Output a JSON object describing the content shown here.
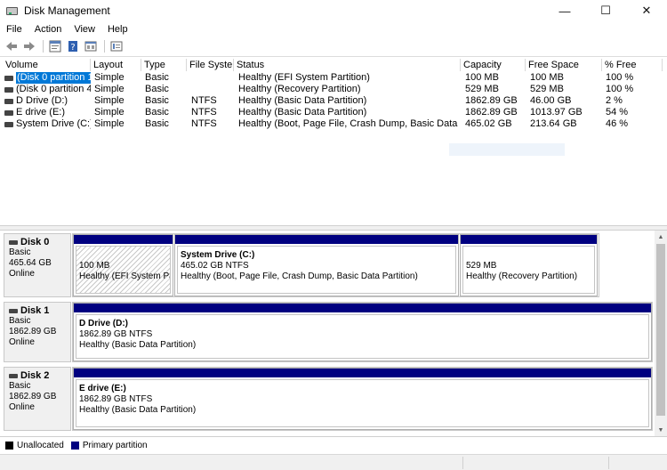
{
  "window": {
    "title": "Disk Management",
    "minimize_glyph": "—",
    "maximize_glyph": "☐",
    "close_glyph": "✕"
  },
  "menu": [
    "File",
    "Action",
    "View",
    "Help"
  ],
  "toolbar": {
    "icons": [
      "back-arrow-icon",
      "forward-arrow-icon",
      "properties-icon",
      "help-icon",
      "show-hide-pane-icon",
      "console-tree-icon"
    ]
  },
  "volume_list": {
    "columns": [
      "Volume",
      "Layout",
      "Type",
      "File Syste...",
      "Status",
      "Capacity",
      "Free Space",
      "% Free"
    ],
    "rows": [
      {
        "volume": "(Disk 0 partition 1)",
        "layout": "Simple",
        "type": "Basic",
        "fs": "",
        "status": "Healthy (EFI System Partition)",
        "capacity": "100 MB",
        "free": "100 MB",
        "pct": "100 %",
        "selected": true
      },
      {
        "volume": "(Disk 0 partition 4)",
        "layout": "Simple",
        "type": "Basic",
        "fs": "",
        "status": "Healthy (Recovery Partition)",
        "capacity": "529 MB",
        "free": "529 MB",
        "pct": "100 %",
        "selected": false
      },
      {
        "volume": "D Drive (D:)",
        "layout": "Simple",
        "type": "Basic",
        "fs": "NTFS",
        "status": "Healthy (Basic Data Partition)",
        "capacity": "1862.89 GB",
        "free": "46.00 GB",
        "pct": "2 %",
        "selected": false
      },
      {
        "volume": "E drive (E:)",
        "layout": "Simple",
        "type": "Basic",
        "fs": "NTFS",
        "status": "Healthy (Basic Data Partition)",
        "capacity": "1862.89 GB",
        "free": "1013.97 GB",
        "pct": "54 %",
        "selected": false
      },
      {
        "volume": "System Drive (C:)",
        "layout": "Simple",
        "type": "Basic",
        "fs": "NTFS",
        "status": "Healthy (Boot, Page File, Crash Dump, Basic Data Partition)",
        "capacity": "465.02 GB",
        "free": "213.64 GB",
        "pct": "46 %",
        "selected": false
      }
    ]
  },
  "disks": [
    {
      "name": "Disk 0",
      "type": "Basic",
      "size": "465.64 GB",
      "state": "Online",
      "partitions": [
        {
          "label": "",
          "size": "100 MB",
          "status": "Healthy (EFI System Partiti",
          "hatched": true
        },
        {
          "label": "System Drive  (C:)",
          "size": "465.02 GB NTFS",
          "status": "Healthy (Boot, Page File, Crash Dump, Basic Data Partition)",
          "hatched": false
        },
        {
          "label": "",
          "size": "529 MB",
          "status": "Healthy (Recovery Partition)",
          "hatched": false
        }
      ]
    },
    {
      "name": "Disk 1",
      "type": "Basic",
      "size": "1862.89 GB",
      "state": "Online",
      "partitions": [
        {
          "label": "D Drive  (D:)",
          "size": "1862.89 GB NTFS",
          "status": "Healthy (Basic Data Partition)",
          "hatched": false
        }
      ]
    },
    {
      "name": "Disk 2",
      "type": "Basic",
      "size": "1862.89 GB",
      "state": "Online",
      "partitions": [
        {
          "label": "E drive  (E:)",
          "size": "1862.89 GB NTFS",
          "status": "Healthy (Basic Data Partition)",
          "hatched": false
        }
      ]
    }
  ],
  "legend": [
    {
      "label": "Unallocated",
      "color": "#000000"
    },
    {
      "label": "Primary partition",
      "color": "#000080"
    }
  ],
  "colors": {
    "partition_bar": "#000080",
    "selection": "#0078d7"
  }
}
